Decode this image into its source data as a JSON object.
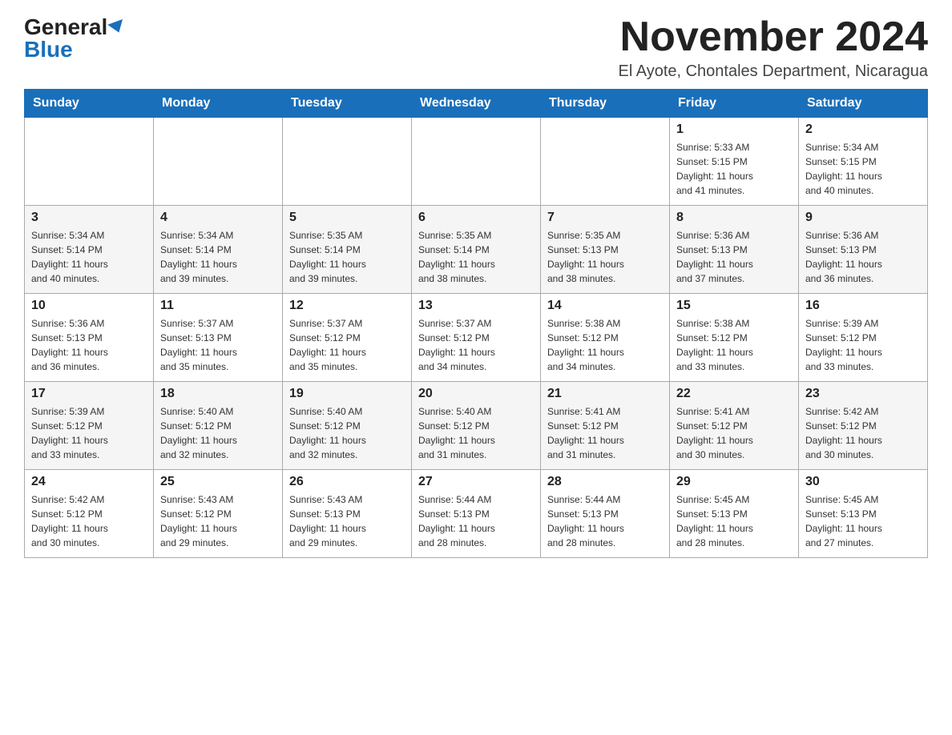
{
  "header": {
    "logo_general": "General",
    "logo_blue": "Blue",
    "month_title": "November 2024",
    "location": "El Ayote, Chontales Department, Nicaragua"
  },
  "days_of_week": [
    "Sunday",
    "Monday",
    "Tuesday",
    "Wednesday",
    "Thursday",
    "Friday",
    "Saturday"
  ],
  "weeks": [
    [
      {
        "day": "",
        "info": ""
      },
      {
        "day": "",
        "info": ""
      },
      {
        "day": "",
        "info": ""
      },
      {
        "day": "",
        "info": ""
      },
      {
        "day": "",
        "info": ""
      },
      {
        "day": "1",
        "info": "Sunrise: 5:33 AM\nSunset: 5:15 PM\nDaylight: 11 hours\nand 41 minutes."
      },
      {
        "day": "2",
        "info": "Sunrise: 5:34 AM\nSunset: 5:15 PM\nDaylight: 11 hours\nand 40 minutes."
      }
    ],
    [
      {
        "day": "3",
        "info": "Sunrise: 5:34 AM\nSunset: 5:14 PM\nDaylight: 11 hours\nand 40 minutes."
      },
      {
        "day": "4",
        "info": "Sunrise: 5:34 AM\nSunset: 5:14 PM\nDaylight: 11 hours\nand 39 minutes."
      },
      {
        "day": "5",
        "info": "Sunrise: 5:35 AM\nSunset: 5:14 PM\nDaylight: 11 hours\nand 39 minutes."
      },
      {
        "day": "6",
        "info": "Sunrise: 5:35 AM\nSunset: 5:14 PM\nDaylight: 11 hours\nand 38 minutes."
      },
      {
        "day": "7",
        "info": "Sunrise: 5:35 AM\nSunset: 5:13 PM\nDaylight: 11 hours\nand 38 minutes."
      },
      {
        "day": "8",
        "info": "Sunrise: 5:36 AM\nSunset: 5:13 PM\nDaylight: 11 hours\nand 37 minutes."
      },
      {
        "day": "9",
        "info": "Sunrise: 5:36 AM\nSunset: 5:13 PM\nDaylight: 11 hours\nand 36 minutes."
      }
    ],
    [
      {
        "day": "10",
        "info": "Sunrise: 5:36 AM\nSunset: 5:13 PM\nDaylight: 11 hours\nand 36 minutes."
      },
      {
        "day": "11",
        "info": "Sunrise: 5:37 AM\nSunset: 5:13 PM\nDaylight: 11 hours\nand 35 minutes."
      },
      {
        "day": "12",
        "info": "Sunrise: 5:37 AM\nSunset: 5:12 PM\nDaylight: 11 hours\nand 35 minutes."
      },
      {
        "day": "13",
        "info": "Sunrise: 5:37 AM\nSunset: 5:12 PM\nDaylight: 11 hours\nand 34 minutes."
      },
      {
        "day": "14",
        "info": "Sunrise: 5:38 AM\nSunset: 5:12 PM\nDaylight: 11 hours\nand 34 minutes."
      },
      {
        "day": "15",
        "info": "Sunrise: 5:38 AM\nSunset: 5:12 PM\nDaylight: 11 hours\nand 33 minutes."
      },
      {
        "day": "16",
        "info": "Sunrise: 5:39 AM\nSunset: 5:12 PM\nDaylight: 11 hours\nand 33 minutes."
      }
    ],
    [
      {
        "day": "17",
        "info": "Sunrise: 5:39 AM\nSunset: 5:12 PM\nDaylight: 11 hours\nand 33 minutes."
      },
      {
        "day": "18",
        "info": "Sunrise: 5:40 AM\nSunset: 5:12 PM\nDaylight: 11 hours\nand 32 minutes."
      },
      {
        "day": "19",
        "info": "Sunrise: 5:40 AM\nSunset: 5:12 PM\nDaylight: 11 hours\nand 32 minutes."
      },
      {
        "day": "20",
        "info": "Sunrise: 5:40 AM\nSunset: 5:12 PM\nDaylight: 11 hours\nand 31 minutes."
      },
      {
        "day": "21",
        "info": "Sunrise: 5:41 AM\nSunset: 5:12 PM\nDaylight: 11 hours\nand 31 minutes."
      },
      {
        "day": "22",
        "info": "Sunrise: 5:41 AM\nSunset: 5:12 PM\nDaylight: 11 hours\nand 30 minutes."
      },
      {
        "day": "23",
        "info": "Sunrise: 5:42 AM\nSunset: 5:12 PM\nDaylight: 11 hours\nand 30 minutes."
      }
    ],
    [
      {
        "day": "24",
        "info": "Sunrise: 5:42 AM\nSunset: 5:12 PM\nDaylight: 11 hours\nand 30 minutes."
      },
      {
        "day": "25",
        "info": "Sunrise: 5:43 AM\nSunset: 5:12 PM\nDaylight: 11 hours\nand 29 minutes."
      },
      {
        "day": "26",
        "info": "Sunrise: 5:43 AM\nSunset: 5:13 PM\nDaylight: 11 hours\nand 29 minutes."
      },
      {
        "day": "27",
        "info": "Sunrise: 5:44 AM\nSunset: 5:13 PM\nDaylight: 11 hours\nand 28 minutes."
      },
      {
        "day": "28",
        "info": "Sunrise: 5:44 AM\nSunset: 5:13 PM\nDaylight: 11 hours\nand 28 minutes."
      },
      {
        "day": "29",
        "info": "Sunrise: 5:45 AM\nSunset: 5:13 PM\nDaylight: 11 hours\nand 28 minutes."
      },
      {
        "day": "30",
        "info": "Sunrise: 5:45 AM\nSunset: 5:13 PM\nDaylight: 11 hours\nand 27 minutes."
      }
    ]
  ]
}
